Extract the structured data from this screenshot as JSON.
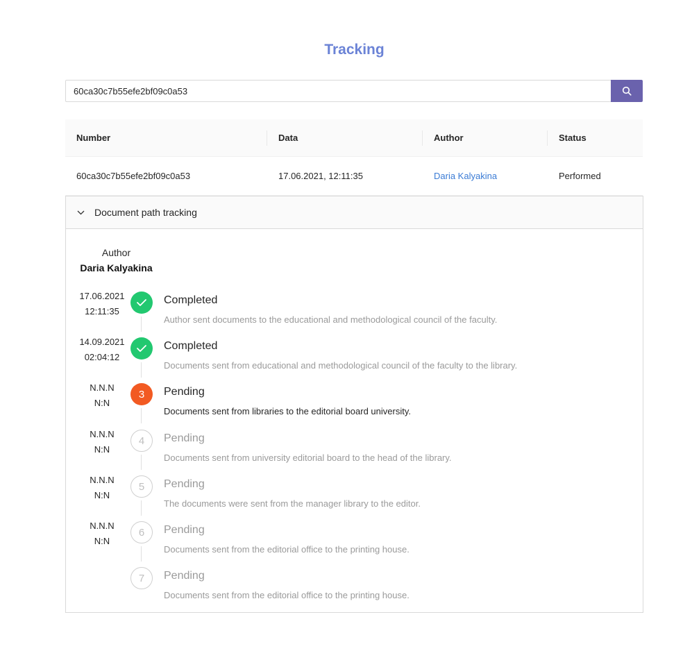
{
  "page": {
    "title": "Tracking"
  },
  "search": {
    "value": "60ca30c7b55efe2bf09c0a53",
    "button_icon": "search-icon"
  },
  "table": {
    "columns": [
      "Number",
      "Data",
      "Author",
      "Status"
    ],
    "row": {
      "number": "60ca30c7b55efe2bf09c0a53",
      "date": "17.06.2021, 12:11:35",
      "author": "Daria Kalyakina",
      "status": "Performed"
    }
  },
  "tracking": {
    "header": "Document path tracking",
    "author_label": "Author",
    "author_name": "Daria Kalyakina",
    "steps": [
      {
        "date": "17.06.2021",
        "time": "12:11:35",
        "state": "done",
        "number": "",
        "title": "Completed",
        "description": "Author sent documents to the educational and methodological council of the faculty."
      },
      {
        "date": "14.09.2021",
        "time": "02:04:12",
        "state": "done",
        "number": "",
        "title": "Completed",
        "description": "Documents sent from educational and methodological council of the faculty to the library."
      },
      {
        "date": "N.N.N",
        "time": "N:N",
        "state": "active",
        "number": "3",
        "title": "Pending",
        "description": "Documents sent from libraries to the editorial board university."
      },
      {
        "date": "N.N.N",
        "time": "N:N",
        "state": "wait",
        "number": "4",
        "title": "Pending",
        "description": "Documents sent from university editorial board to the head of the library."
      },
      {
        "date": "N.N.N",
        "time": "N:N",
        "state": "wait",
        "number": "5",
        "title": "Pending",
        "description": "The documents were sent from the manager library to the editor."
      },
      {
        "date": "N.N.N",
        "time": "N:N",
        "state": "wait",
        "number": "6",
        "title": "Pending",
        "description": "Documents sent from the editorial office to the printing house."
      },
      {
        "date": "",
        "time": "",
        "state": "wait",
        "number": "7",
        "title": "Pending",
        "description": "Documents sent from the editorial office to the printing house."
      }
    ]
  },
  "colors": {
    "title": "#6b83d6",
    "search_button": "#6a62ad",
    "done": "#22c870",
    "active": "#f25a22",
    "link": "#3a7bd5"
  }
}
